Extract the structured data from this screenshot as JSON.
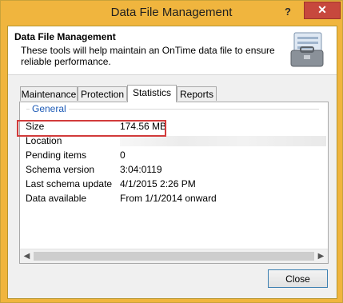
{
  "window": {
    "title": "Data File Management",
    "help_glyph": "?",
    "close_glyph": "✕"
  },
  "header": {
    "title": "Data File Management",
    "description": "These tools will help maintain an OnTime data file to ensure reliable performance."
  },
  "tabs": [
    {
      "label": "Maintenance"
    },
    {
      "label": "Protection"
    },
    {
      "label": "Statistics",
      "active": true
    },
    {
      "label": "Reports"
    }
  ],
  "group": {
    "title": "General"
  },
  "stats": [
    {
      "label": "Size",
      "value": "174.56 MB"
    },
    {
      "label": "Location",
      "value": ""
    },
    {
      "label": "Pending items",
      "value": "0"
    },
    {
      "label": "Schema version",
      "value": "3:04:0119"
    },
    {
      "label": "Last schema update",
      "value": "4/1/2015 2:26 PM"
    },
    {
      "label": "Data available",
      "value": "From 1/1/2014 onward"
    }
  ],
  "scrollbar": {
    "left_arrow": "◀",
    "right_arrow": "▶"
  },
  "footer": {
    "close_label": "Close"
  },
  "colors": {
    "titlebar": "#f0b53e",
    "close": "#c7483d",
    "highlight": "#d23b3b",
    "group_title": "#1c5ab6"
  }
}
